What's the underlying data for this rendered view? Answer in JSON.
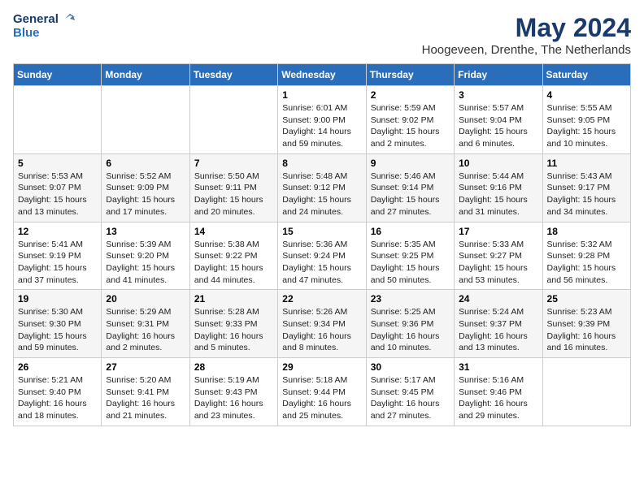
{
  "header": {
    "logo_line1": "General",
    "logo_line2": "Blue",
    "month_year": "May 2024",
    "location": "Hoogeveen, Drenthe, The Netherlands"
  },
  "weekdays": [
    "Sunday",
    "Monday",
    "Tuesday",
    "Wednesday",
    "Thursday",
    "Friday",
    "Saturday"
  ],
  "weeks": [
    {
      "days": [
        {
          "num": "",
          "detail": ""
        },
        {
          "num": "",
          "detail": ""
        },
        {
          "num": "",
          "detail": ""
        },
        {
          "num": "1",
          "detail": "Sunrise: 6:01 AM\nSunset: 9:00 PM\nDaylight: 14 hours\nand 59 minutes."
        },
        {
          "num": "2",
          "detail": "Sunrise: 5:59 AM\nSunset: 9:02 PM\nDaylight: 15 hours\nand 2 minutes."
        },
        {
          "num": "3",
          "detail": "Sunrise: 5:57 AM\nSunset: 9:04 PM\nDaylight: 15 hours\nand 6 minutes."
        },
        {
          "num": "4",
          "detail": "Sunrise: 5:55 AM\nSunset: 9:05 PM\nDaylight: 15 hours\nand 10 minutes."
        }
      ]
    },
    {
      "days": [
        {
          "num": "5",
          "detail": "Sunrise: 5:53 AM\nSunset: 9:07 PM\nDaylight: 15 hours\nand 13 minutes."
        },
        {
          "num": "6",
          "detail": "Sunrise: 5:52 AM\nSunset: 9:09 PM\nDaylight: 15 hours\nand 17 minutes."
        },
        {
          "num": "7",
          "detail": "Sunrise: 5:50 AM\nSunset: 9:11 PM\nDaylight: 15 hours\nand 20 minutes."
        },
        {
          "num": "8",
          "detail": "Sunrise: 5:48 AM\nSunset: 9:12 PM\nDaylight: 15 hours\nand 24 minutes."
        },
        {
          "num": "9",
          "detail": "Sunrise: 5:46 AM\nSunset: 9:14 PM\nDaylight: 15 hours\nand 27 minutes."
        },
        {
          "num": "10",
          "detail": "Sunrise: 5:44 AM\nSunset: 9:16 PM\nDaylight: 15 hours\nand 31 minutes."
        },
        {
          "num": "11",
          "detail": "Sunrise: 5:43 AM\nSunset: 9:17 PM\nDaylight: 15 hours\nand 34 minutes."
        }
      ]
    },
    {
      "days": [
        {
          "num": "12",
          "detail": "Sunrise: 5:41 AM\nSunset: 9:19 PM\nDaylight: 15 hours\nand 37 minutes."
        },
        {
          "num": "13",
          "detail": "Sunrise: 5:39 AM\nSunset: 9:20 PM\nDaylight: 15 hours\nand 41 minutes."
        },
        {
          "num": "14",
          "detail": "Sunrise: 5:38 AM\nSunset: 9:22 PM\nDaylight: 15 hours\nand 44 minutes."
        },
        {
          "num": "15",
          "detail": "Sunrise: 5:36 AM\nSunset: 9:24 PM\nDaylight: 15 hours\nand 47 minutes."
        },
        {
          "num": "16",
          "detail": "Sunrise: 5:35 AM\nSunset: 9:25 PM\nDaylight: 15 hours\nand 50 minutes."
        },
        {
          "num": "17",
          "detail": "Sunrise: 5:33 AM\nSunset: 9:27 PM\nDaylight: 15 hours\nand 53 minutes."
        },
        {
          "num": "18",
          "detail": "Sunrise: 5:32 AM\nSunset: 9:28 PM\nDaylight: 15 hours\nand 56 minutes."
        }
      ]
    },
    {
      "days": [
        {
          "num": "19",
          "detail": "Sunrise: 5:30 AM\nSunset: 9:30 PM\nDaylight: 15 hours\nand 59 minutes."
        },
        {
          "num": "20",
          "detail": "Sunrise: 5:29 AM\nSunset: 9:31 PM\nDaylight: 16 hours\nand 2 minutes."
        },
        {
          "num": "21",
          "detail": "Sunrise: 5:28 AM\nSunset: 9:33 PM\nDaylight: 16 hours\nand 5 minutes."
        },
        {
          "num": "22",
          "detail": "Sunrise: 5:26 AM\nSunset: 9:34 PM\nDaylight: 16 hours\nand 8 minutes."
        },
        {
          "num": "23",
          "detail": "Sunrise: 5:25 AM\nSunset: 9:36 PM\nDaylight: 16 hours\nand 10 minutes."
        },
        {
          "num": "24",
          "detail": "Sunrise: 5:24 AM\nSunset: 9:37 PM\nDaylight: 16 hours\nand 13 minutes."
        },
        {
          "num": "25",
          "detail": "Sunrise: 5:23 AM\nSunset: 9:39 PM\nDaylight: 16 hours\nand 16 minutes."
        }
      ]
    },
    {
      "days": [
        {
          "num": "26",
          "detail": "Sunrise: 5:21 AM\nSunset: 9:40 PM\nDaylight: 16 hours\nand 18 minutes."
        },
        {
          "num": "27",
          "detail": "Sunrise: 5:20 AM\nSunset: 9:41 PM\nDaylight: 16 hours\nand 21 minutes."
        },
        {
          "num": "28",
          "detail": "Sunrise: 5:19 AM\nSunset: 9:43 PM\nDaylight: 16 hours\nand 23 minutes."
        },
        {
          "num": "29",
          "detail": "Sunrise: 5:18 AM\nSunset: 9:44 PM\nDaylight: 16 hours\nand 25 minutes."
        },
        {
          "num": "30",
          "detail": "Sunrise: 5:17 AM\nSunset: 9:45 PM\nDaylight: 16 hours\nand 27 minutes."
        },
        {
          "num": "31",
          "detail": "Sunrise: 5:16 AM\nSunset: 9:46 PM\nDaylight: 16 hours\nand 29 minutes."
        },
        {
          "num": "",
          "detail": ""
        }
      ]
    }
  ]
}
